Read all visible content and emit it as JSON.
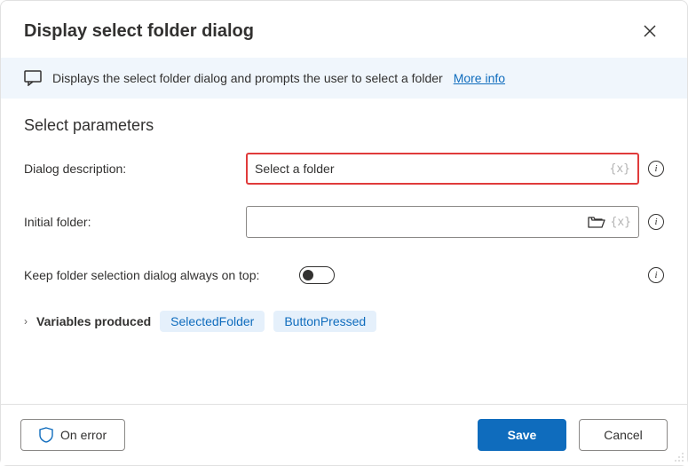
{
  "header": {
    "title": "Display select folder dialog"
  },
  "description": {
    "text": "Displays the select folder dialog and prompts the user to select a folder",
    "more_info": "More info"
  },
  "section": {
    "title": "Select parameters"
  },
  "fields": {
    "dialog_description": {
      "label": "Dialog description:",
      "value": "Select a folder",
      "highlight_color": "#e03b3b"
    },
    "initial_folder": {
      "label": "Initial folder:",
      "value": ""
    },
    "keep_on_top": {
      "label": "Keep folder selection dialog always on top:",
      "value": false
    }
  },
  "variables": {
    "label": "Variables produced",
    "items": [
      "SelectedFolder",
      "ButtonPressed"
    ]
  },
  "footer": {
    "on_error": "On error",
    "save": "Save",
    "cancel": "Cancel"
  },
  "colors": {
    "accent": "#0f6cbd",
    "info_bg": "#f0f6fc",
    "chip_bg": "#e5f0fb"
  }
}
